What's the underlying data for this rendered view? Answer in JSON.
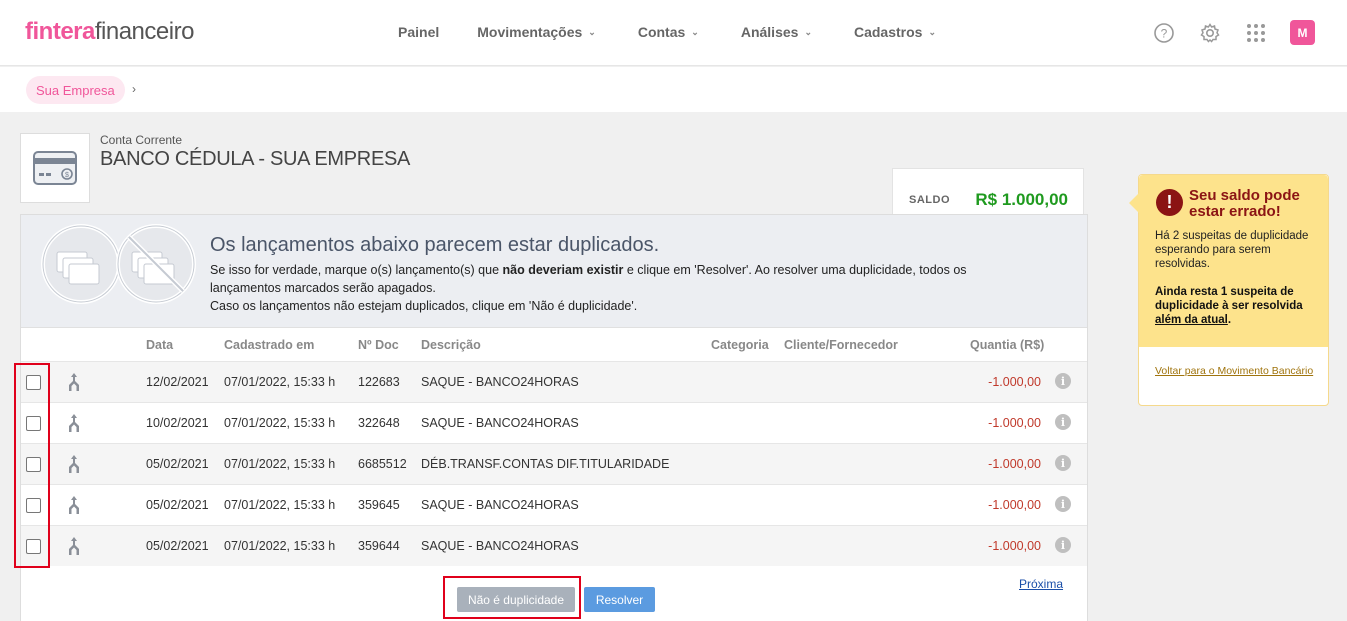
{
  "brand": {
    "bold": "fintera",
    "light": "financeiro"
  },
  "nav": {
    "items": [
      {
        "label": "Painel",
        "chevron": false
      },
      {
        "label": "Movimentações",
        "chevron": true
      },
      {
        "label": "Contas",
        "chevron": true
      },
      {
        "label": "Análises",
        "chevron": true
      },
      {
        "label": "Cadastros",
        "chevron": true
      }
    ],
    "avatar": "M",
    "icons": [
      "help-icon",
      "gear-icon",
      "apps-grid-icon"
    ]
  },
  "breadcrumb": {
    "item": "Sua Empresa",
    "sep": "›"
  },
  "account": {
    "type": "Conta Corrente",
    "name": "BANCO CÉDULA - SUA EMPRESA",
    "saldo_label": "SALDO",
    "saldo_value": "R$ 1.000,00"
  },
  "banner": {
    "title": "Os lançamentos abaixo parecem estar duplicados.",
    "line1_a": "Se isso for verdade, marque o(s) lançamento(s) que ",
    "line1_bold": "não deveriam existir",
    "line1_b": " e clique em 'Resolver'. Ao resolver uma duplicidade, todos os lançamentos marcados serão apagados.",
    "line2": "Caso os lançamentos não estejam duplicados, clique em 'Não é duplicidade'."
  },
  "table": {
    "headers": {
      "data": "Data",
      "cadastrado": "Cadastrado em",
      "doc": "Nº Doc",
      "descricao": "Descrição",
      "categoria": "Categoria",
      "cliente": "Cliente/Fornecedor",
      "quantia": "Quantia (R$)"
    },
    "rows": [
      {
        "data": "12/02/2021",
        "cadastrado": "07/01/2022, 15:33 h",
        "doc": "122683",
        "descricao": "SAQUE - BANCO24HORAS",
        "quantia": "-1.000,00"
      },
      {
        "data": "10/02/2021",
        "cadastrado": "07/01/2022, 15:33 h",
        "doc": "322648",
        "descricao": "SAQUE - BANCO24HORAS",
        "quantia": "-1.000,00"
      },
      {
        "data": "05/02/2021",
        "cadastrado": "07/01/2022, 15:33 h",
        "doc": "6685512",
        "descricao": "DÉB.TRANSF.CONTAS DIF.TITULARIDADE",
        "quantia": "-1.000,00"
      },
      {
        "data": "05/02/2021",
        "cadastrado": "07/01/2022, 15:33 h",
        "doc": "359645",
        "descricao": "SAQUE - BANCO24HORAS",
        "quantia": "-1.000,00"
      },
      {
        "data": "05/02/2021",
        "cadastrado": "07/01/2022, 15:33 h",
        "doc": "359644",
        "descricao": "SAQUE - BANCO24HORAS",
        "quantia": "-1.000,00"
      }
    ]
  },
  "actions": {
    "nao_duplicidade": "Não é duplicidade",
    "resolver": "Resolver",
    "proxima": "Próxima"
  },
  "warning": {
    "title": "Seu saldo pode estar errado!",
    "p1": "Há 2 suspeitas de duplicidade esperando para serem resolvidas.",
    "p2_a": "Ainda resta 1 suspeita de duplicidade à ser resolvida ",
    "p2_u": "além da atual",
    "p2_b": ".",
    "link": "Voltar para o Movimento Bancário",
    "icon": "!"
  },
  "colors": {
    "brand": "#f0569a",
    "saldo": "#1f9a1f",
    "negative": "#c0392b",
    "warning_bg": "#fde38c",
    "warning_title": "#8b1414",
    "highlight": "#e0001b"
  }
}
